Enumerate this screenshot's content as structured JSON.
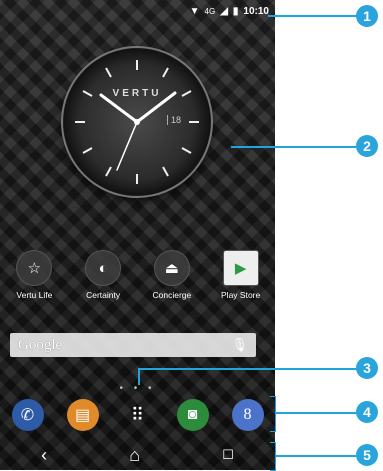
{
  "status": {
    "network": "4G",
    "time": "10:10"
  },
  "clock": {
    "brand": "VERTU",
    "date": "18"
  },
  "apps": [
    {
      "label": "Vertu Life",
      "icon": "star-icon"
    },
    {
      "label": "Certainty",
      "icon": "shield-icon"
    },
    {
      "label": "Concierge",
      "icon": "bell-icon"
    },
    {
      "label": "Play Store",
      "icon": "play-store-icon"
    }
  ],
  "search": {
    "label": "Google",
    "icon": "mic-icon"
  },
  "dock": [
    "phone-icon",
    "messages-icon",
    "app-drawer-icon",
    "camera-icon",
    "google-plus-icon"
  ],
  "navbar": [
    "back-icon",
    "home-icon",
    "recents-icon"
  ],
  "callouts": [
    "1",
    "2",
    "3",
    "4",
    "5"
  ],
  "colors": {
    "accent": "#1ea5dc",
    "badge": "#2aa4dc"
  }
}
